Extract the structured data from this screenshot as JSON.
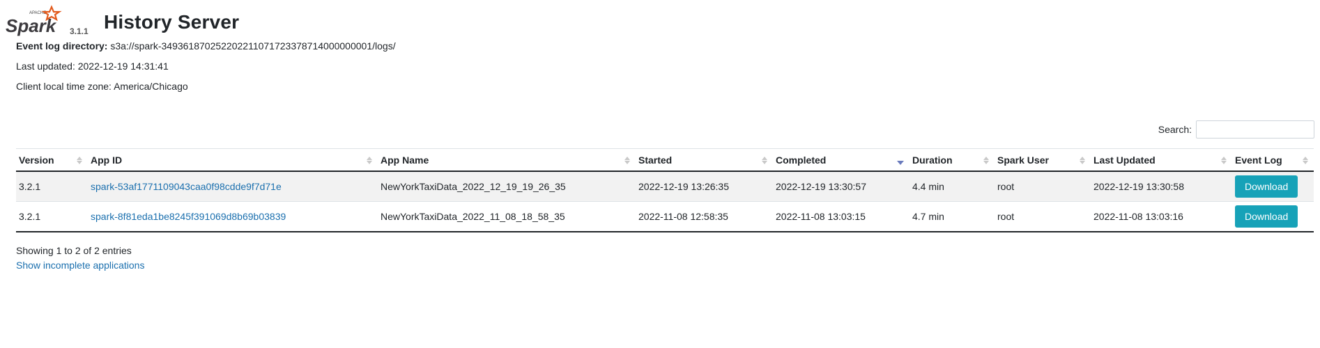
{
  "header": {
    "logo_text": "Spark",
    "logo_sub": "APACHE",
    "spark_version": "3.1.1",
    "title": "History Server"
  },
  "info": {
    "event_log_label": "Event log directory:",
    "event_log_value": "s3a://spark-349361870252202211071723378714000000001/logs/",
    "last_updated": "Last updated: 2022-12-19 14:31:41",
    "timezone": "Client local time zone: America/Chicago"
  },
  "search": {
    "label": "Search:",
    "placeholder": ""
  },
  "table": {
    "columns": [
      "Version",
      "App ID",
      "App Name",
      "Started",
      "Completed",
      "Duration",
      "Spark User",
      "Last Updated",
      "Event Log"
    ],
    "rows": [
      {
        "version": "3.2.1",
        "app_id": "spark-53af1771109043caa0f98cdde9f7d71e",
        "app_name": "NewYorkTaxiData_2022_12_19_19_26_35",
        "started": "2022-12-19 13:26:35",
        "completed": "2022-12-19 13:30:57",
        "duration": "4.4 min",
        "user": "root",
        "last_updated": "2022-12-19 13:30:58",
        "event_log": "Download"
      },
      {
        "version": "3.2.1",
        "app_id": "spark-8f81eda1be8245f391069d8b69b03839",
        "app_name": "NewYorkTaxiData_2022_11_08_18_58_35",
        "started": "2022-11-08 12:58:35",
        "completed": "2022-11-08 13:03:15",
        "duration": "4.7 min",
        "user": "root",
        "last_updated": "2022-11-08 13:03:16",
        "event_log": "Download"
      }
    ]
  },
  "footer": {
    "showing": "Showing 1 to 2 of 2 entries",
    "incomplete_link": "Show incomplete applications"
  },
  "colors": {
    "accent": "#17a2b8",
    "link": "#1a6fae",
    "star": "#e25a1c"
  }
}
